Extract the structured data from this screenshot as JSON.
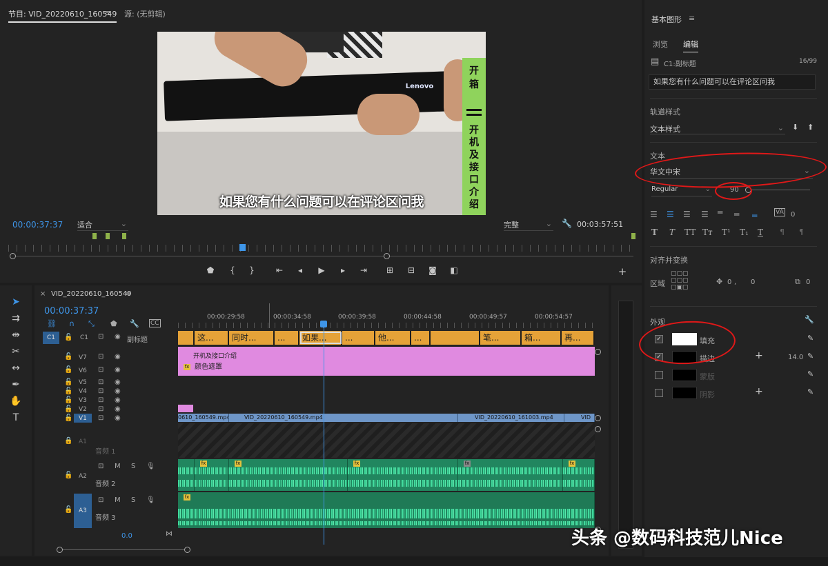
{
  "monitor": {
    "tab_program": "节目: VID_20220610_160549",
    "tab_source": "源: (无剪辑)",
    "subtitle": "如果您有什么问题可以在评论区问我",
    "strip_top": [
      "开",
      "箱"
    ],
    "strip_bottom": [
      "开",
      "机",
      "及",
      "接",
      "口",
      "介",
      "绍"
    ],
    "lenovo": "Lenovo",
    "timecode": "00:00:37:37",
    "fit_label": "适合",
    "quality_label": "完整",
    "duration": "00:03:57:51"
  },
  "timeline": {
    "tab": "VID_20220610_160549",
    "timecode": "00:00:37:37",
    "ticks": [
      "00:00:29:58",
      "00:00:34:58",
      "00:00:39:58",
      "00:00:44:58",
      "00:00:49:57",
      "00:00:54:57"
    ],
    "track_labels": [
      "C1",
      "V7",
      "V6",
      "V5",
      "V4",
      "V3",
      "V2",
      "V1",
      "A1",
      "A2",
      "A3"
    ],
    "c1_name": "副标题",
    "a1_name": "音频 1",
    "a2_name": "音频 2",
    "a3_name": "音频 3",
    "master_value": "0.0",
    "c1_clips": [
      "这...",
      "同时...",
      "...",
      "如果...",
      "...",
      "他...",
      "...",
      "笔...",
      "箱...",
      "再..."
    ],
    "v7_clip": "开机及接口介绍",
    "v6_clip": "颜色遮罩",
    "v1_clips": [
      "0610_160549.mp4",
      "VID_20220610_160549.mp4",
      "VID_20220610_161003.mp4",
      "VID"
    ]
  },
  "eg": {
    "title": "基本图形",
    "tab_browse": "浏览",
    "tab_edit": "编辑",
    "layer": "C1:副标题",
    "count": "16/99",
    "text_value": "如果您有什么问题可以在评论区问我",
    "track_style": "轨道样式",
    "text_style": "文本样式",
    "text_section": "文本",
    "font": "华文中宋",
    "weight": "Regular",
    "size": "90",
    "tracking": "0",
    "align_section": "对齐并变换",
    "region": "区域",
    "pos_x": "0",
    "pos_y": "0",
    "scale": "0",
    "appearance": "外观",
    "fill_label": "填充",
    "stroke_label": "描边",
    "stroke_width": "14.0",
    "shadow_label": "阴影",
    "mask_label": "蒙版",
    "fill_color": "#ffffff",
    "stroke_color": "#000000"
  },
  "watermark": "头条 @数码科技范儿Nice"
}
